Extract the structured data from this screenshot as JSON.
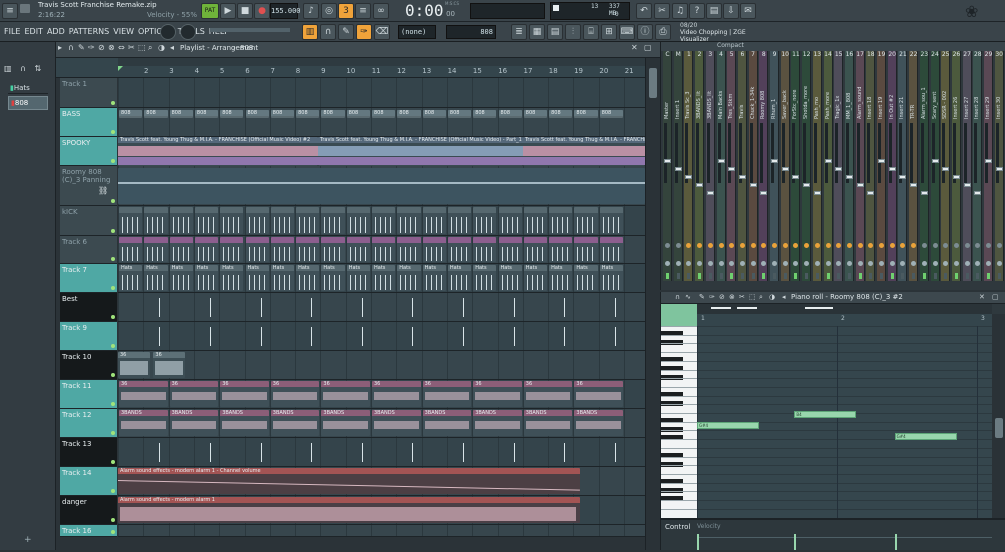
{
  "app": {
    "project_title": "Travis Scott Franchise Remake.zip",
    "song_position_small": "2:16:22",
    "hint_text": "Velocity - 55%",
    "pattern_mode": "PAT",
    "tempo": "155.000",
    "time_display": "0:00",
    "time_sub": "00",
    "time_label": "M:S:CS",
    "cpu_value": "13",
    "memory": "337 MB",
    "voices": "0",
    "news_counter": "08/20",
    "news_text": "Video Chopping | ZGE Visualizer",
    "snap_value": "(none)",
    "pattern_value": "808"
  },
  "menu": [
    "FILE",
    "EDIT",
    "ADD",
    "PATTERNS",
    "VIEW",
    "OPTIONS",
    "TOOLS",
    "HELP"
  ],
  "browser": {
    "items": [
      {
        "label": "Hats",
        "selected": false
      },
      {
        "label": "808",
        "selected": true
      }
    ]
  },
  "playlist": {
    "title": "Playlist - Arrangement",
    "pattern_crumb": "808",
    "ruler": [
      "2",
      "3",
      "4",
      "5",
      "6",
      "7",
      "8",
      "9",
      "10",
      "11",
      "12",
      "13",
      "14",
      "15",
      "16",
      "17",
      "18",
      "19",
      "20",
      "21"
    ],
    "tracks": [
      {
        "name": "Track 1",
        "style": "dark",
        "height": 30
      },
      {
        "name": "BASS",
        "style": "teal",
        "height": 29
      },
      {
        "name": "SPOOKY",
        "style": "teal",
        "height": 29
      },
      {
        "name": "Roomy 808 (C)_3 Panning",
        "style": "dark",
        "height": 40
      },
      {
        "name": "kICK",
        "style": "dark",
        "height": 30
      },
      {
        "name": "Track 6",
        "style": "dark",
        "height": 28
      },
      {
        "name": "Track 7",
        "style": "teal",
        "height": 29
      },
      {
        "name": "Best",
        "style": "black",
        "height": 29
      },
      {
        "name": "Track 9",
        "style": "teal",
        "height": 29
      },
      {
        "name": "Track 10",
        "style": "black",
        "height": 29
      },
      {
        "name": "Track 11",
        "style": "teal",
        "height": 29
      },
      {
        "name": "Track 12",
        "style": "teal",
        "height": 29
      },
      {
        "name": "Track 13",
        "style": "black",
        "height": 29
      },
      {
        "name": "Track 14",
        "style": "teal",
        "height": 29
      },
      {
        "name": "danger",
        "style": "black",
        "height": 29
      },
      {
        "name": "Track 16",
        "style": "teal",
        "height": 12
      }
    ],
    "clips": {
      "bass": "808",
      "spooky": "Travis Scott feat. Young Thug & M.I.A. - FRANCHISE (Official Music Video) #2",
      "spooky2": "Travis Scott feat. Young Thug & M.I.A. - FRANCHISE (Official Music Video) - Part_1",
      "spooky3": "Travis Scott feat. Young Thug & M.I.A. - FRANCHISE (Official Music Video) #2",
      "hats": "Hats",
      "jbands": "3BANDS",
      "alarm_auto": "Alarm sound effects - modern alarm 1 - Channel volume",
      "alarm_audio": "Alarm sound effects - modern alarm 1",
      "small": "36"
    }
  },
  "mixer": {
    "channels": [
      {
        "num": "C",
        "name": "Master"
      },
      {
        "num": "M",
        "name": "Insert 1"
      },
      {
        "num": "1",
        "name": "Travis Sc_3"
      },
      {
        "num": "2",
        "name": "3BANDS_lit"
      },
      {
        "num": "3",
        "name": "3BANDS_lit"
      },
      {
        "num": "4",
        "name": "Main Backs"
      },
      {
        "num": "5",
        "name": "Tres_Stkm"
      },
      {
        "num": "6",
        "name": "Travis"
      },
      {
        "num": "7",
        "name": "Chuck_1-34k"
      },
      {
        "num": "8",
        "name": "Roomy 808"
      },
      {
        "num": "9",
        "name": "Rhum_1"
      },
      {
        "num": "10",
        "name": "Saver_back"
      },
      {
        "num": "11",
        "name": "ForStc_nore"
      },
      {
        "num": "12",
        "name": "Shotda_more"
      },
      {
        "num": "13",
        "name": "Pash_mo"
      },
      {
        "num": "14",
        "name": "Pash_more"
      },
      {
        "num": "15",
        "name": "Tragic_1x"
      },
      {
        "num": "16",
        "name": "MM_1_808"
      },
      {
        "num": "17",
        "name": "Alarm_sound"
      },
      {
        "num": "18",
        "name": "Insert 18"
      },
      {
        "num": "19",
        "name": "Insert 19"
      },
      {
        "num": "20",
        "name": "In Out #2"
      },
      {
        "num": "21",
        "name": "Insert 21"
      },
      {
        "num": "22",
        "name": "TR-TR"
      },
      {
        "num": "23",
        "name": "Alarm_sou_1"
      },
      {
        "num": "24",
        "name": "Scary_sent"
      },
      {
        "num": "25",
        "name": "SDSR - 002"
      },
      {
        "num": "26",
        "name": "Insert 26"
      },
      {
        "num": "27",
        "name": "Insert 27"
      },
      {
        "num": "28",
        "name": "Insert 28"
      },
      {
        "num": "29",
        "name": "Insert 29"
      },
      {
        "num": "30",
        "name": "Insert 30"
      }
    ],
    "view_label": "Compact"
  },
  "pianoroll": {
    "title": "Piano roll - Roomy 808 (C)_3 #2",
    "bar_labels": [
      "1",
      "2",
      "3"
    ],
    "notes": [
      {
        "label": "G#4",
        "start": 0.0,
        "length": 0.21,
        "row": 0
      },
      {
        "label": "B4",
        "start": 0.33,
        "length": 0.21,
        "row": -1
      },
      {
        "label": "G#4",
        "start": 0.67,
        "length": 0.21,
        "row": 1
      }
    ],
    "control_label": "Control",
    "control_value": "Velocity"
  }
}
